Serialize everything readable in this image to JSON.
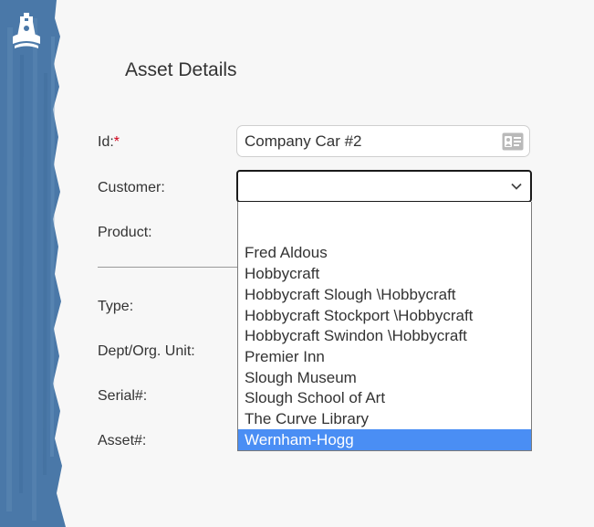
{
  "page": {
    "title": "Asset Details"
  },
  "form": {
    "id_label": "Id:",
    "id_required_mark": "*",
    "id_value": "Company Car #2",
    "customer_label": "Customer:",
    "customer_value": "",
    "product_label": "Product:",
    "type_label": "Type:",
    "dept_label": "Dept/Org. Unit:",
    "serial_label": "Serial#:",
    "asset_label": "Asset#:"
  },
  "customer_dropdown": {
    "options": [
      "",
      "Fred Aldous",
      "Hobbycraft",
      "Hobbycraft Slough \\Hobbycraft",
      "Hobbycraft Stockport \\Hobbycraft",
      "Hobbycraft Swindon \\Hobbycraft",
      "Premier Inn",
      "Slough Museum",
      "Slough School of Art",
      "The Curve Library",
      "Wernham-Hogg"
    ],
    "highlighted": "Wernham-Hogg"
  },
  "icons": {
    "logo": "lighthouse-logo-icon",
    "id_field": "id-card-icon",
    "select": "chevron-down-icon"
  },
  "colors": {
    "brand_blue": "#4a78a8",
    "highlight": "#4a8ef4",
    "required": "#d0021b"
  }
}
